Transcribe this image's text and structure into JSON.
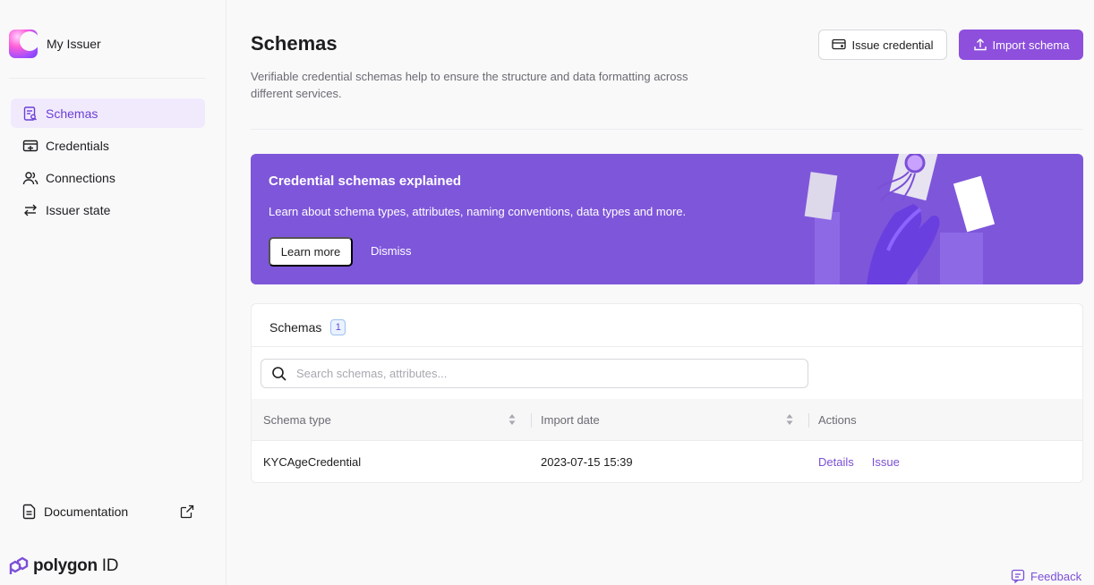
{
  "sidebar": {
    "brand_name": "My Issuer",
    "items": [
      {
        "label": "Schemas",
        "icon": "schemas-icon",
        "active": true
      },
      {
        "label": "Credentials",
        "icon": "credentials-icon",
        "active": false
      },
      {
        "label": "Connections",
        "icon": "connections-icon",
        "active": false
      },
      {
        "label": "Issuer state",
        "icon": "issuer-state-icon",
        "active": false
      }
    ],
    "documentation_label": "Documentation",
    "logo_text": "polygon",
    "logo_suffix": "ID"
  },
  "header": {
    "title": "Schemas",
    "subtitle": "Verifiable credential schemas help to ensure the structure and data formatting across different services.",
    "issue_credential_label": "Issue credential",
    "import_schema_label": "Import schema"
  },
  "banner": {
    "title": "Credential schemas explained",
    "text": "Learn about schema types, attributes, naming conventions, data types and more.",
    "learn_more_label": "Learn more",
    "dismiss_label": "Dismiss"
  },
  "schemas_card": {
    "title": "Schemas",
    "count": "1",
    "search_placeholder": "Search schemas, attributes...",
    "columns": [
      "Schema type",
      "Import date",
      "Actions"
    ],
    "rows": [
      {
        "schema_type": "KYCAgeCredential",
        "import_date": "2023-07-15 15:39",
        "actions": [
          "Details",
          "Issue"
        ]
      }
    ]
  },
  "feedback_label": "Feedback",
  "colors": {
    "accent": "#8d4fdc",
    "banner": "#7e56da",
    "link": "#7b4fd6",
    "active_nav_bg": "#f1eafd"
  }
}
